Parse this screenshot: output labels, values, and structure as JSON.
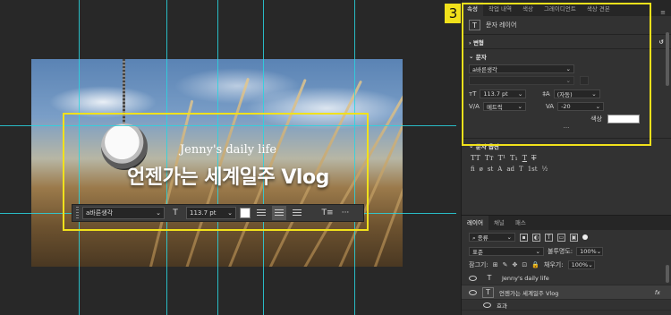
{
  "canvas": {
    "subtitle": "Jenny's daily life",
    "title": "언젠가는 세계일주 Vlog"
  },
  "context_bar": {
    "font": "a바른생각",
    "size_icon": "T",
    "size": "113.7 pt",
    "more": "···"
  },
  "step_badge": "3",
  "panel": {
    "tabs": [
      "속성",
      "작업 내역",
      "색상",
      "그레이디언트",
      "색상 견본"
    ],
    "layer_kind": "문자 레이어",
    "transform": "변형",
    "char_section": "문자",
    "font": "a바른생각",
    "font_size": "113.7 pt",
    "leading": "(자동)",
    "kerning": "메트릭",
    "tracking": "-20",
    "color_label": "색상",
    "text_options": "문자 옵션",
    "text_style_glyphs": [
      "TT",
      "Tт",
      "T¹",
      "T₁",
      "T",
      "T"
    ],
    "opentype_glyphs": [
      "fi",
      "ø",
      "st",
      "A",
      "ad",
      "T",
      "1st",
      "½"
    ]
  },
  "layers": {
    "tabs": [
      "레이어",
      "채널",
      "패스"
    ],
    "filter_kind": "종류",
    "blend_mode": "표준",
    "opacity_label": "불투명도:",
    "opacity": "100%",
    "lock_label": "잠그기:",
    "fill_label": "채우기:",
    "fill": "100%",
    "rows": [
      {
        "name": "Jenny's daily life"
      },
      {
        "name": "언젠가는 세계일주 Vlog",
        "fx": "fx"
      }
    ],
    "effect_label": "효과"
  }
}
